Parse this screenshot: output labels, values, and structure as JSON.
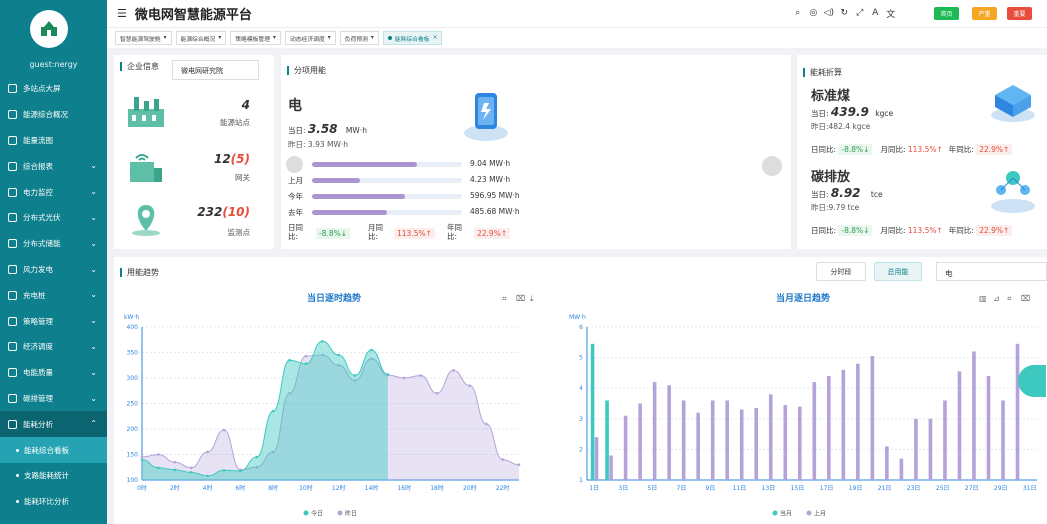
{
  "app": {
    "title": "微电网智慧能源平台",
    "user": "guest:nergy"
  },
  "header": {
    "buttons": [
      {
        "label": "首页",
        "color": "#1db954"
      },
      {
        "label": "严重",
        "color": "#f5a623"
      },
      {
        "label": "重要",
        "color": "#e74c3c"
      }
    ]
  },
  "sidebar": {
    "items": [
      {
        "label": "多站点大屏",
        "expand": false
      },
      {
        "label": "能源综合概况",
        "expand": false
      },
      {
        "label": "能量流图",
        "expand": false
      },
      {
        "label": "综合报表",
        "expand": true
      },
      {
        "label": "电力监控",
        "expand": true
      },
      {
        "label": "分布式光伏",
        "expand": true
      },
      {
        "label": "分布式储能",
        "expand": true
      },
      {
        "label": "风力发电",
        "expand": true
      },
      {
        "label": "充电桩",
        "expand": true
      },
      {
        "label": "策略管理",
        "expand": true
      },
      {
        "label": "经济调度",
        "expand": true
      },
      {
        "label": "电能质量",
        "expand": true
      },
      {
        "label": "碳排管理",
        "expand": true
      },
      {
        "label": "能耗分析",
        "expand": true
      }
    ],
    "sub": [
      "能耗综合看板",
      "支路能耗统计",
      "能耗环比分析"
    ]
  },
  "tabs": [
    "智慧能源驾驶舱",
    "能源综合概况",
    "策略模板管理",
    "动态经济调度",
    "负荷预测",
    "能耗综合看板"
  ],
  "company": {
    "title": "企业信息",
    "select": "微电网研究院",
    "stats": [
      {
        "value": "4",
        "label": "能源站点"
      },
      {
        "value": "12",
        "extra": "(5)",
        "label": "网关"
      },
      {
        "value": "232",
        "extra": "(10)",
        "label": "监测点"
      }
    ]
  },
  "energy": {
    "title": "分项用能",
    "name": "电",
    "today_label": "当日:",
    "today": "3.58",
    "unit": "MW·h",
    "yesterday": "昨日: 3.93 MW·h",
    "bars": [
      {
        "label": "当月",
        "value": "9.04 MW·h",
        "fill": 0.7
      },
      {
        "label": "上月",
        "value": "4.23 MW·h",
        "fill": 0.32
      },
      {
        "label": "今年",
        "value": "596.95 MW·h",
        "fill": 0.62
      },
      {
        "label": "去年",
        "value": "485.68 MW·h",
        "fill": 0.5
      }
    ],
    "yoy_label": "日同比:",
    "yoy": "-8.8%↓",
    "mom_label": "月同比:",
    "mom": "113.5%↑",
    "year_label": "年同比:",
    "year": "22.9%↑"
  },
  "conv": {
    "title": "能耗折算",
    "items": [
      {
        "name": "标准煤",
        "today_label": "当日:",
        "today": "439.9",
        "unit": "kgce",
        "yesterday": "昨日:482.4 kgce",
        "yoy_label": "日同比:",
        "yoy": "-8.8%↓",
        "mom_label": "月同比:",
        "mom": "113.5%↑",
        "year_label": "年同比:",
        "year": "22.9%↑"
      },
      {
        "name": "碳排放",
        "today_label": "当日:",
        "today": "8.92",
        "unit": "tce",
        "yesterday": "昨日:9.79 tce",
        "yoy_label": "日同比:",
        "yoy": "-8.8%↓",
        "mom_label": "月同比:",
        "mom": "113.5%↑",
        "year_label": "年同比:",
        "year": "22.9%↑"
      }
    ]
  },
  "trend": {
    "title": "用能趋势",
    "btn1": "分时段",
    "btn2": "总用能",
    "select": "电"
  },
  "chart_data": [
    {
      "type": "area",
      "title": "当日逐时趋势",
      "ylabel": "kW·h",
      "ylim": [
        100,
        400
      ],
      "y_ticks": [
        "100",
        "150",
        "200",
        "250",
        "300",
        "350",
        "400"
      ],
      "x_ticks": [
        "0时",
        "2时",
        "4时",
        "6时",
        "8时",
        "10时",
        "12时",
        "14时",
        "16时",
        "18时",
        "20时",
        "22时"
      ],
      "x": [
        0,
        1,
        2,
        3,
        4,
        5,
        6,
        7,
        8,
        9,
        10,
        11,
        12,
        13,
        14,
        15,
        16,
        17,
        18,
        19,
        20,
        21,
        22,
        23
      ],
      "series": [
        {
          "name": "今日",
          "color": "#3dc9c0",
          "values": [
            140,
            124,
            120,
            115,
            108,
            119,
            118,
            145,
            235,
            335,
            328,
            372,
            345,
            305,
            355,
            307
          ]
        },
        {
          "name": "昨日",
          "color": "#b4a3d9",
          "values": [
            145,
            150,
            135,
            124,
            155,
            198,
            120,
            125,
            155,
            270,
            343,
            345,
            325,
            295,
            338,
            306,
            300,
            305,
            270,
            315,
            285,
            210,
            140,
            130
          ]
        }
      ],
      "legend": "bottom"
    },
    {
      "type": "bar",
      "title": "当月逐日趋势",
      "ylabel": "MW·h",
      "ylim": [
        1,
        6
      ],
      "y_ticks": [
        "1",
        "2",
        "3",
        "4",
        "5",
        "6"
      ],
      "x_ticks": [
        "1日",
        "3日",
        "5日",
        "7日",
        "9日",
        "11日",
        "13日",
        "15日",
        "17日",
        "19日",
        "21日",
        "23日",
        "25日",
        "27日",
        "29日",
        "31日"
      ],
      "categories": [
        1,
        2,
        3,
        4,
        5,
        6,
        7,
        8,
        9,
        10,
        11,
        12,
        13,
        14,
        15,
        16,
        17,
        18,
        19,
        20,
        21,
        22,
        23,
        24,
        25,
        26,
        27,
        28,
        29,
        30,
        31
      ],
      "series": [
        {
          "name": "当月",
          "color": "#3dc9c0",
          "values": [
            5.45,
            3.6
          ]
        },
        {
          "name": "上月",
          "color": "#b4a3d9",
          "values": [
            2.4,
            1.8,
            3.1,
            3.5,
            4.2,
            4.1,
            3.6,
            3.2,
            3.6,
            3.6,
            3.3,
            3.35,
            3.8,
            3.45,
            3.4,
            4.2,
            4.4,
            4.6,
            4.8,
            5.05,
            2.1,
            1.7,
            3.0,
            3.0,
            3.6,
            4.55,
            5.2,
            4.4,
            3.6,
            5.45,
            0
          ]
        }
      ],
      "legend": "bottom"
    }
  ]
}
